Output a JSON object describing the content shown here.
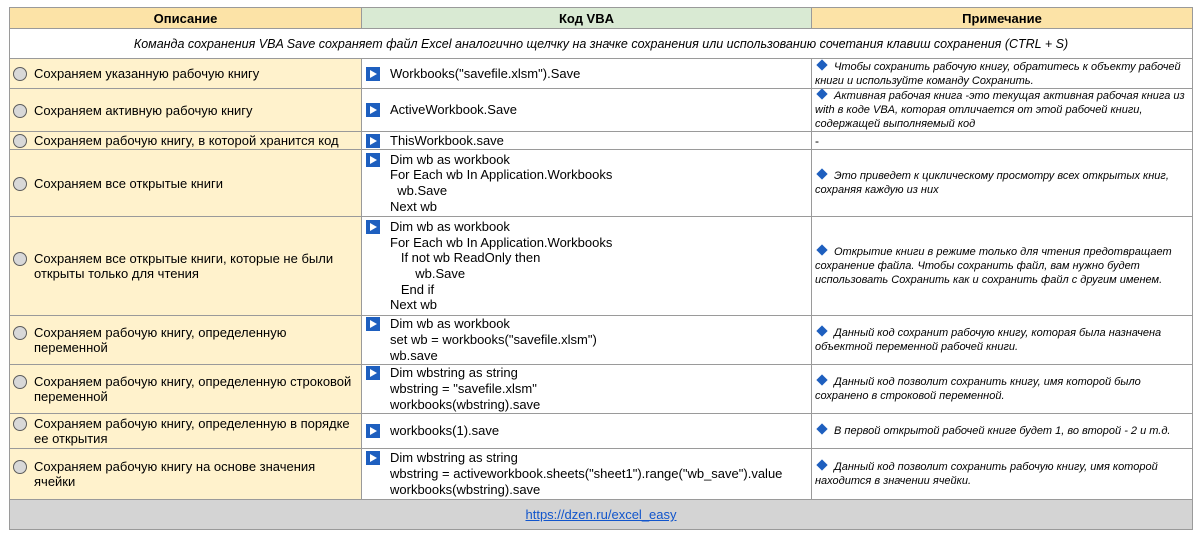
{
  "headers": {
    "description": "Описание",
    "code": "Код VBA",
    "note": "Примечание"
  },
  "intro": "Команда сохранения VBA  Save сохраняет файл Excel аналогично щелчку на значке сохранения или использованию сочетания клавиш сохранения (CTRL + S)",
  "rows": [
    {
      "description": "Сохраняем указанную рабочую книгу",
      "code": "Workbooks(\"savefile.xlsm\").Save",
      "note": "Чтобы сохранить рабочую книгу, обратитесь к объекту рабочей книги и используйте команду Сохранить."
    },
    {
      "description": "Сохраняем активную рабочую книгу",
      "code": "ActiveWorkbook.Save",
      "note": "Активная рабочая книга -это текущая активная рабочая книга из with в коде VBA, которая отличается от этой рабочей книги, содержащей выполняемый код"
    },
    {
      "description": "Сохраняем рабочую книгу, в которой хранится код",
      "code": "ThisWorkbook.save",
      "note": "-"
    },
    {
      "description": "Сохраняем все открытые книги",
      "code": "Dim wb as workbook\nFor Each wb In Application.Workbooks\n  wb.Save\nNext wb",
      "note": "Это приведет к циклическому просмотру всех открытых книг, сохраняя каждую из них"
    },
    {
      "description": "Сохраняем все открытые книги, которые не были открыты только для чтения",
      "code": "Dim wb as workbook\nFor Each wb In Application.Workbooks\n   If not wb ReadOnly then\n       wb.Save\n   End if\nNext wb",
      "note": "Открытие книги в режиме только для чтения предотвращает сохранение файла.  Чтобы сохранить файл, вам нужно будет использовать Сохранить как и сохранить файл с другим именем."
    },
    {
      "description": "Сохраняем рабочую книгу, определенную переменной",
      "code": "Dim wb as workbook\nset wb = workbooks(\"savefile.xlsm\")\nwb.save",
      "note": "Данный код сохранит рабочую книгу, которая была назначена объектной переменной рабочей книги."
    },
    {
      "description": "Сохраняем рабочую книгу, определенную строковой переменной",
      "code": "Dim wbstring as string\nwbstring = \"savefile.xlsm\"\nworkbooks(wbstring).save",
      "note": "Данный код позволит сохранить книгу, имя которой было сохранено в строковой переменной."
    },
    {
      "description": "Сохраняем рабочую книгу, определенную в порядке ее открытия",
      "code": "workbooks(1).save",
      "note": "В первой открытой рабочей книге будет 1, во второй - 2 и т.д."
    },
    {
      "description": "Сохраняем рабочую книгу на основе значения ячейки",
      "code": "Dim wbstring as string\nwbstring = activeworkbook.sheets(\"sheet1\").range(\"wb_save\").value\nworkbooks(wbstring).save",
      "note": "Данный код позволит сохранить рабочую книгу, имя которой находится в значении ячейки."
    }
  ],
  "footer_link": "https://dzen.ru/excel_easy",
  "icons": {
    "description": "radio-icon",
    "code": "play-icon",
    "note": "diamond-icon"
  },
  "colors": {
    "header_description": "#fce3a7",
    "header_code": "#d9ead3",
    "description_cell": "#fff2cc",
    "icon_blue": "#1e5fbf",
    "footer": "#d4d4d4",
    "link": "#1155cc"
  }
}
